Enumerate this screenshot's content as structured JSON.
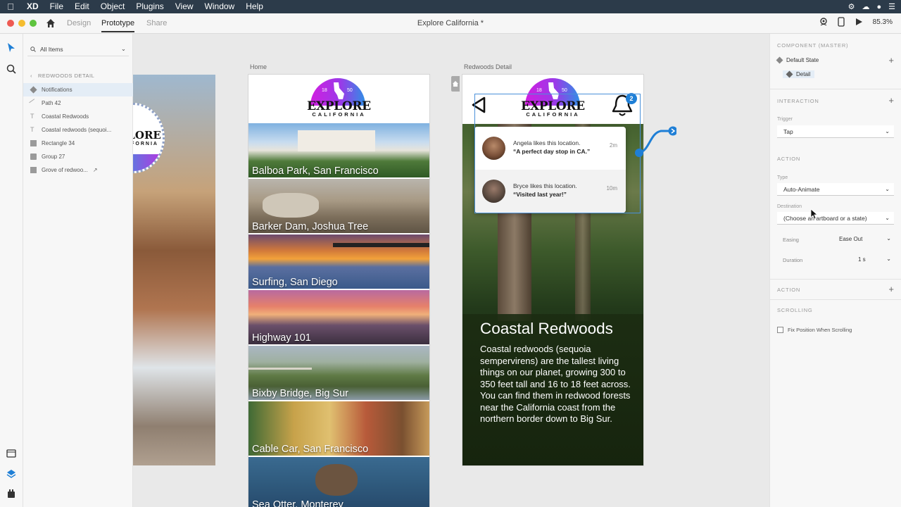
{
  "menubar": {
    "app_name": "XD",
    "items": [
      "File",
      "Edit",
      "Object",
      "Plugins",
      "View",
      "Window",
      "Help"
    ]
  },
  "toolbar": {
    "tabs": [
      "Design",
      "Prototype",
      "Share"
    ],
    "active_tab": "Prototype",
    "doc_title": "Explore California *",
    "zoom": "85.3%"
  },
  "layers": {
    "search_placeholder": "All Items",
    "breadcrumb": "REDWOODS DETAIL",
    "items": [
      {
        "label": "Notifications",
        "icon": "component-icon"
      },
      {
        "label": "Path 42",
        "icon": "pen-path-icon"
      },
      {
        "label": "Coastal Redwoods",
        "icon": "text-icon"
      },
      {
        "label": "Coastal redwoods (sequoi...",
        "icon": "text-icon"
      },
      {
        "label": "Rectangle 34",
        "icon": "rectangle-icon"
      },
      {
        "label": "Group 27",
        "icon": "folder-icon"
      },
      {
        "label": "Grove of redwoo...",
        "icon": "image-icon"
      }
    ]
  },
  "canvas": {
    "home_label": "Home",
    "detail_label": "Redwoods Detail",
    "logo": {
      "title": "EXPLORE",
      "subtitle": "CALIFORNIA",
      "num_left": "18",
      "num_right": "50"
    },
    "tiles": [
      "Balboa Park, San Francisco",
      "Barker Dam, Joshua Tree",
      "Surfing, San Diego",
      "Highway 101",
      "Bixby Bridge, Big Sur",
      "Cable Car, San Francisco",
      "Sea Otter, Monterey"
    ],
    "bell_count": "2",
    "notifications": [
      {
        "line1": "Angela likes this location.",
        "line2": "“A perfect day stop in CA.”",
        "time": "2m"
      },
      {
        "line1": "Bryce likes this location.",
        "line2": "“Visited last year!”",
        "time": "10m"
      }
    ],
    "detail_title": "Coastal Redwoods",
    "detail_body": "Coastal redwoods (sequoia sempervirens) are the tallest living things on our planet, growing 300 to 350 feet tall and 16 to 18 feet across. You can find them in redwood forests near the California coast from the northern border down to Big Sur."
  },
  "inspector": {
    "component_title": "COMPONENT (MASTER)",
    "states": [
      "Default State",
      "Detail"
    ],
    "interaction_title": "INTERACTION",
    "trigger_label": "Trigger",
    "trigger_value": "Tap",
    "action_title": "ACTION",
    "type_label": "Type",
    "type_value": "Auto-Animate",
    "destination_label": "Destination",
    "destination_value": "(Choose an artboard or a state)",
    "easing_label": "Easing",
    "easing_value": "Ease Out",
    "duration_label": "Duration",
    "duration_value": "1 s",
    "action2_title": "ACTION",
    "scrolling_title": "SCROLLING",
    "scroll_option": "Fix Position When Scrolling"
  },
  "colors": {
    "accent": "#1f7fd6",
    "menubar_bg": "#2c3b4a"
  }
}
